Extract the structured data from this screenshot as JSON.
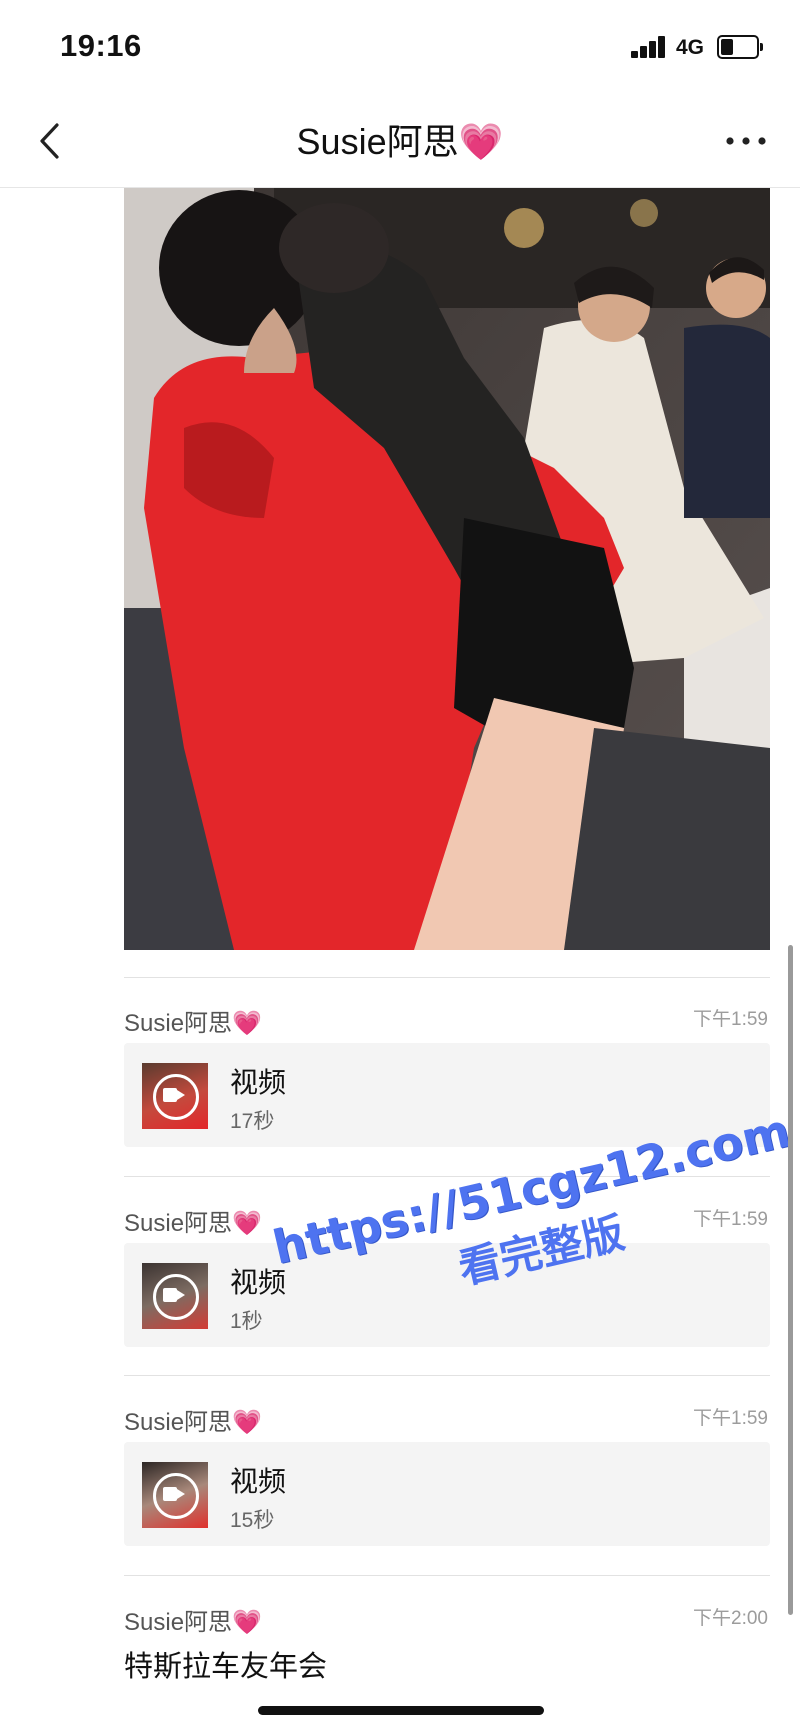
{
  "status_bar": {
    "time": "19:16",
    "network": "4G"
  },
  "nav": {
    "title": "Susie阿思💗"
  },
  "messages": [
    {
      "sender": "Susie阿思💗",
      "time": "下午1:59",
      "video_label": "视频",
      "duration": "17秒"
    },
    {
      "sender": "Susie阿思💗",
      "time": "下午1:59",
      "video_label": "视频",
      "duration": "1秒"
    },
    {
      "sender": "Susie阿思💗",
      "time": "下午1:59",
      "video_label": "视频",
      "duration": "15秒"
    },
    {
      "sender": "Susie阿思💗",
      "time": "下午2:00",
      "text": "特斯拉车友年会"
    }
  ],
  "watermark": {
    "url": "https://51cgz12.com",
    "text": "看完整版"
  },
  "icons": {
    "back": "chevron-left-icon",
    "more": "ellipsis-icon",
    "video": "video-camera-icon",
    "signal": "signal-bars-icon",
    "battery": "battery-icon"
  },
  "colors": {
    "watermark": "#4e73f0",
    "hoodie": "#e3262a"
  }
}
